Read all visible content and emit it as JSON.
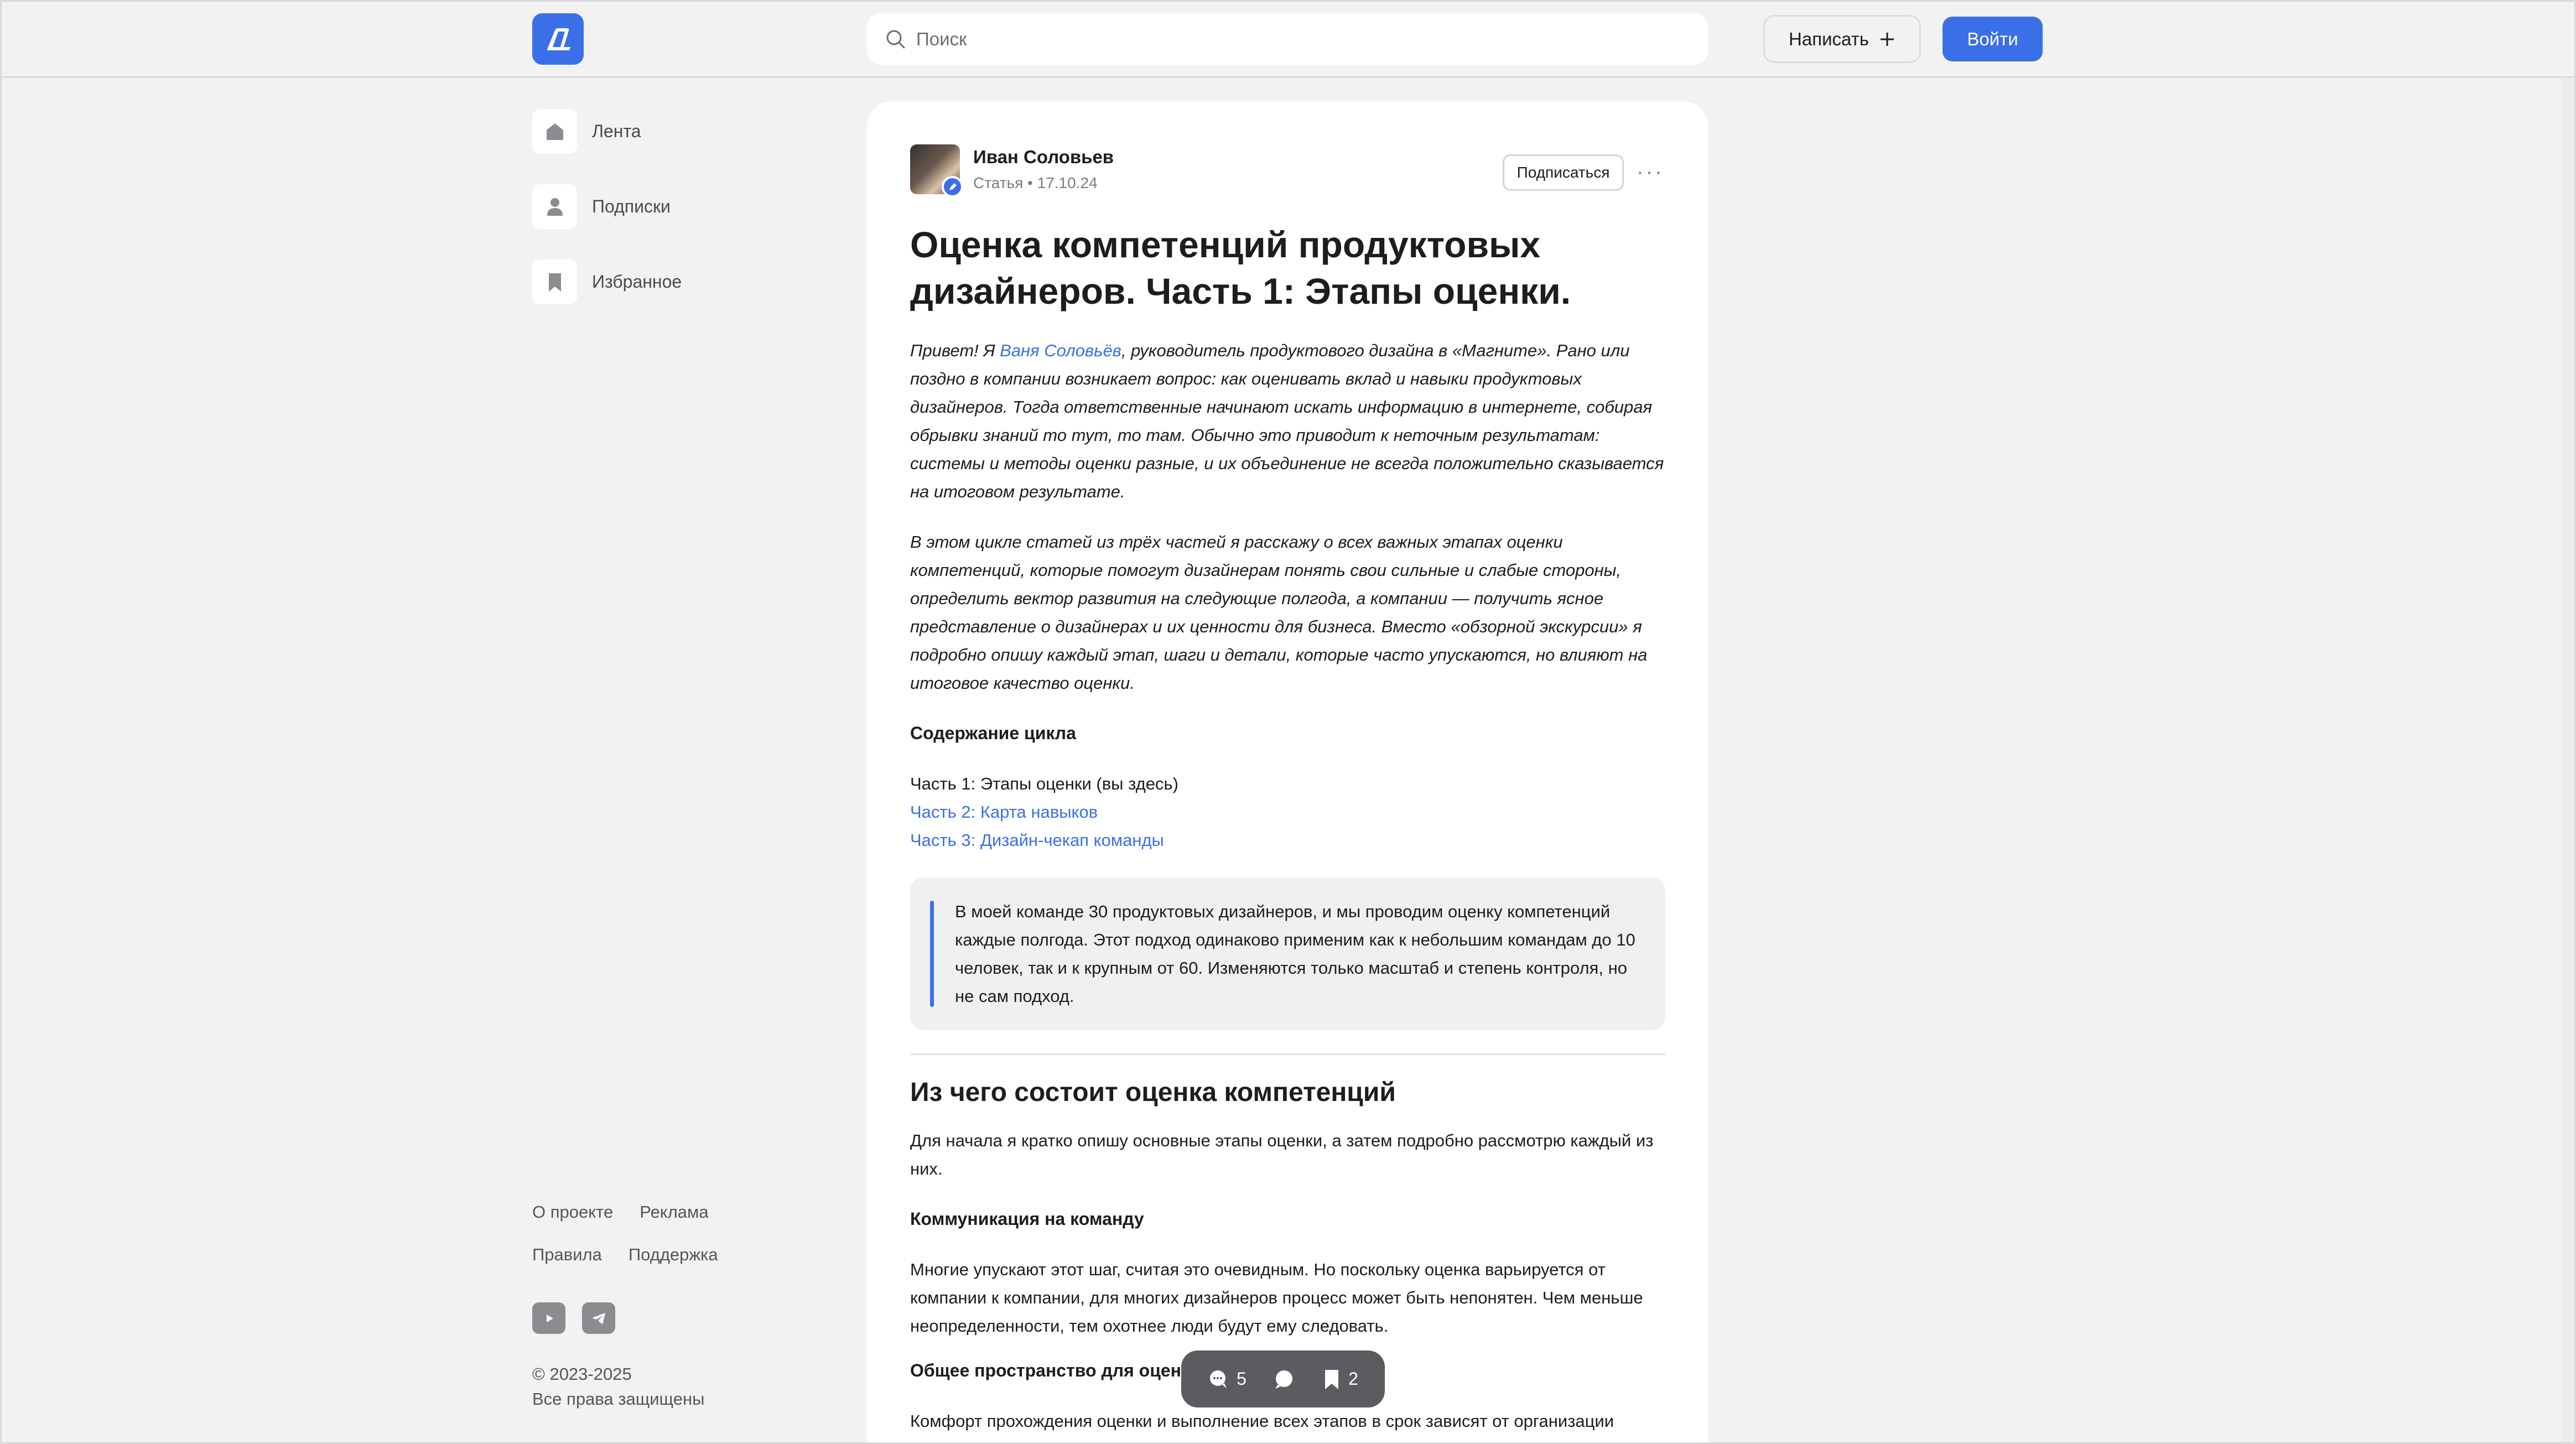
{
  "header": {
    "search_placeholder": "Поиск",
    "write_label": "Написать",
    "login_label": "Войти"
  },
  "sidebar": {
    "items": [
      {
        "label": "Лента",
        "icon": "home-icon"
      },
      {
        "label": "Подписки",
        "icon": "person-icon"
      },
      {
        "label": "Избранное",
        "icon": "bookmark-icon"
      }
    ],
    "footer": {
      "links_row1": [
        "О проекте",
        "Реклама"
      ],
      "links_row2": [
        "Правила",
        "Поддержка"
      ],
      "social": [
        "youtube-icon",
        "telegram-icon"
      ],
      "copyright": "© 2023-2025",
      "rights": "Все права защищены"
    }
  },
  "article": {
    "author_name": "Иван Соловьев",
    "author_meta": "Статья • 17.10.24",
    "subscribe_label": "Подписаться",
    "more_label": "···",
    "title": "Оценка компетенций продуктовых дизайнеров. Часть 1: Этапы оценки.",
    "intro_prefix": "Привет! Я ",
    "intro_link": "Ваня Соловьёв",
    "intro_suffix": ", руководитель продуктового дизайна в «Магните». Рано или поздно в компании возникает вопрос: как оценивать вклад и навыки продуктовых дизайнеров. Тогда ответственные начинают искать информацию в интернете, собирая обрывки знаний то тут, то там. Обычно это приводит к неточным результатам: системы и методы оценки разные, и их объединение не всегда положительно сказывается на итоговом результате.",
    "p2": "В этом цикле статей из трёх частей я расскажу о всех важных этапах оценки компетенций, которые помогут дизайнерам понять свои сильные и слабые стороны, определить вектор развития на следующие полгода, а компании — получить ясное представление о дизайнерах и их ценности для бизнеса. Вместо «обзорной экскурсии» я подробно опишу каждый этап, шаги и детали, которые часто упускаются, но влияют на итоговое качество оценки.",
    "toc_heading": "Содержание цикла",
    "toc": [
      "Часть 1: Этапы оценки (вы здесь)",
      "Часть 2: Карта навыков",
      "Часть 3: Дизайн-чекап команды"
    ],
    "quote": "В моей команде 30 продуктовых дизайнеров, и мы проводим оценку компетенций каждые полгода. Этот подход одинаково применим как к небольшим командам до 10 человек, так и к крупным от 60. Изменяются только масштаб и степень контроля, но не сам подход.",
    "h2": "Из чего состоит оценка компетенций",
    "p3": "Для начала я кратко опишу основные этапы оценки, а затем подробно рассмотрю каждый из них.",
    "sub1": "Коммуникация на команду",
    "p4": "Многие упускают этот шаг, считая это очевидным. Но поскольку оценка варьируется от компании к компании, для многих дизайнеров процесс может быть непонятен. Чем меньше неопределенности, тем охотнее люди будут ему следовать.",
    "sub2": "Общее пространство для оценки",
    "p5": "Комфорт прохождения оценки и выполнение всех этапов в срок зависят от организации"
  },
  "actions": {
    "comments_count": "5",
    "bookmarks_count": "2"
  },
  "colors": {
    "accent": "#3b6fe8",
    "background": "#f2f2f3",
    "card": "#ffffff"
  }
}
